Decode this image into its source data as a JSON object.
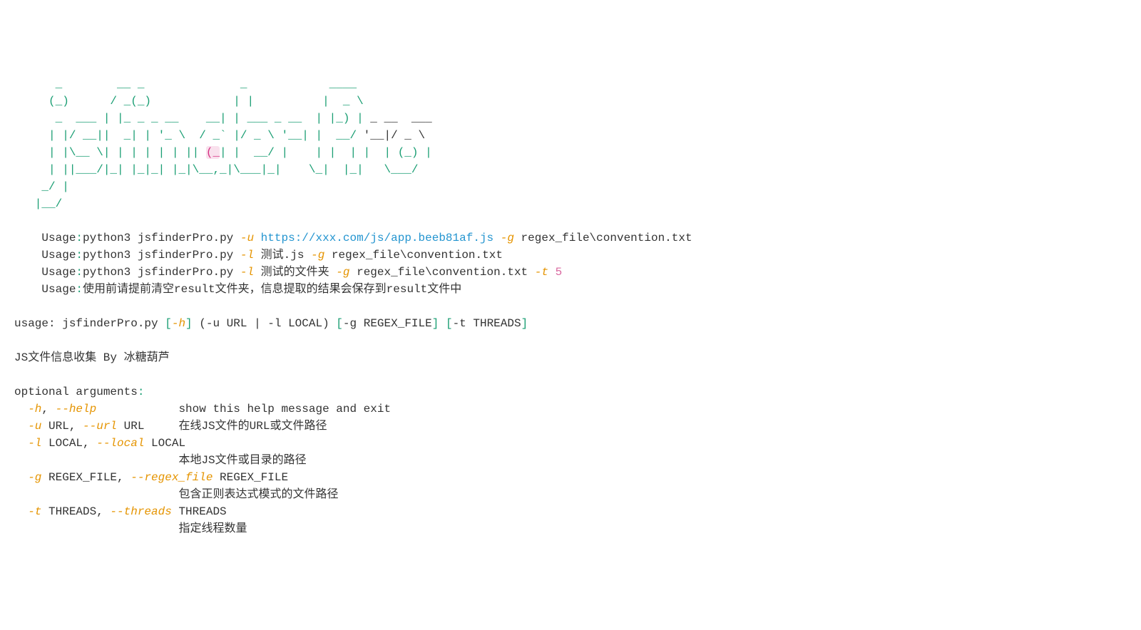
{
  "ascii": {
    "line1": "      _        __ _              _            ____",
    "line2": "     (_)      / _(_)            | |          |  _ \\",
    "line3_a": "      _  ___ | |_ _ _ __    __| | ___ _ __  | |_) |",
    "line3_b": " _ __  ___",
    "line4_a": "     | |/ __||  _| | '_ \\  / _` |/ _ \\ '__| |  __/",
    "line4_b": " '__|/ _ \\",
    "line5_a": "     | |\\__ \\| | | | | | || ",
    "line5_cursor": "(_",
    "line5_b": "| |  __/ |    | |  | |  | (_) |",
    "line6": "     | ||___/|_| |_|_| |_|\\__,_|\\___|_|    \\_|  |_|   \\___/",
    "line7": "    _/ |",
    "line8": "   |__/"
  },
  "usage_lines": {
    "line1": {
      "prefix": "    Usage",
      "colon": ":",
      "cmd": "python3 jsfinderPro.py ",
      "flag_u": "-u",
      "url": " https://xxx.com/js/app.beeb81af.js ",
      "flag_g": "-g",
      "path": " regex_file\\convention.txt"
    },
    "line2": {
      "prefix": "    Usage",
      "colon": ":",
      "cmd": "python3 jsfinderPro.py ",
      "flag_l": "-l",
      "file": " 测试.js ",
      "flag_g": "-g",
      "path": " regex_file\\convention.txt"
    },
    "line3": {
      "prefix": "    Usage",
      "colon": ":",
      "cmd": "python3 jsfinderPro.py ",
      "flag_l": "-l",
      "folder": " 测试的文件夹 ",
      "flag_g": "-g",
      "path": " regex_file\\convention.txt ",
      "flag_t": "-t",
      "space": " ",
      "num": "5"
    },
    "line4": {
      "prefix": "    Usage",
      "colon": ":",
      "text": "使用前请提前清空result文件夹，信息提取的结果会保存到result文件中"
    }
  },
  "usage_syntax": {
    "prefix": "usage: jsfinderPro.py ",
    "lb1": "[",
    "h": "-h",
    "rb1": "]",
    "paren": " (-u URL | -l LOCAL) ",
    "lb2": "[",
    "g": "-g REGEX_FILE",
    "rb2": "]",
    "sp": " ",
    "lb3": "[",
    "t": "-t THREADS",
    "rb3": "]"
  },
  "description": "JS文件信息收集 By 冰糖葫芦",
  "optional_header": "optional arguments",
  "optional_colon": ":",
  "args": {
    "help": {
      "short": "  -h",
      "comma": ", ",
      "long": "--help",
      "pad": "            ",
      "desc": "show this help message and exit"
    },
    "url": {
      "short": "  -u",
      "meta1": " URL, ",
      "long": "--url",
      "meta2": " URL     ",
      "desc": "在线JS文件的URL或文件路径"
    },
    "local": {
      "short": "  -l",
      "meta1": " LOCAL, ",
      "long": "--local",
      "meta2": " LOCAL",
      "pad": "                        ",
      "desc": "本地JS文件或目录的路径"
    },
    "regex": {
      "short": "  -g",
      "meta1": " REGEX_FILE, ",
      "long": "--regex_file",
      "meta2": " REGEX_FILE",
      "pad": "                        ",
      "desc": "包含正则表达式模式的文件路径"
    },
    "threads": {
      "short": "  -t",
      "meta1": " THREADS, ",
      "long": "--threads",
      "meta2": " THREADS",
      "pad": "                        ",
      "desc": "指定线程数量"
    }
  }
}
